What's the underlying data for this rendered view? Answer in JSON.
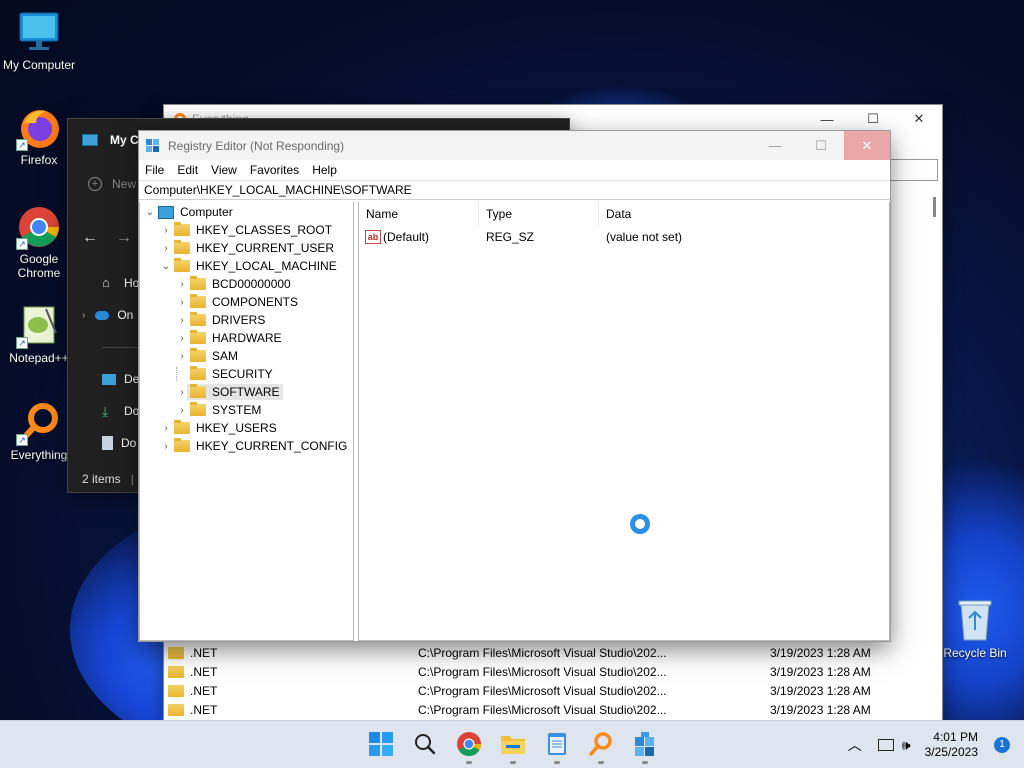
{
  "desktop": {
    "icons": [
      {
        "label": "My Computer"
      },
      {
        "label": "Firefox"
      },
      {
        "label": "Google Chrome"
      },
      {
        "label": "Notepad++"
      },
      {
        "label": "Everything"
      }
    ],
    "recycle_bin": "Recycle Bin"
  },
  "everything_window": {
    "title": "Everything",
    "rows": [
      {
        "name": ".NET",
        "path": "C:\\Program Files\\Microsoft Visual Studio\\202...",
        "date": "3/19/2023 1:28 AM"
      },
      {
        "name": ".NET",
        "path": "C:\\Program Files\\Microsoft Visual Studio\\202...",
        "date": "3/19/2023 1:28 AM"
      },
      {
        "name": ".NET",
        "path": "C:\\Program Files\\Microsoft Visual Studio\\202...",
        "date": "3/19/2023 1:28 AM"
      },
      {
        "name": ".NET",
        "path": "C:\\Program Files\\Microsoft Visual Studio\\202...",
        "date": "3/19/2023 1:28 AM"
      }
    ]
  },
  "explorer_window": {
    "title": "My C",
    "new_label": "New",
    "nav_items": [
      {
        "label": "Ho",
        "icon": "home-icon"
      },
      {
        "label": "On",
        "icon": "cloud-icon"
      },
      {
        "label": "De",
        "icon": "desktop-icon"
      },
      {
        "label": "Do",
        "icon": "download-icon"
      },
      {
        "label": "Do",
        "icon": "document-icon"
      }
    ],
    "status": "2 items"
  },
  "regedit": {
    "title": "Registry Editor (Not Responding)",
    "menu": [
      "File",
      "Edit",
      "View",
      "Favorites",
      "Help"
    ],
    "address": "Computer\\HKEY_LOCAL_MACHINE\\SOFTWARE",
    "tree": {
      "root": "Computer",
      "hives": [
        "HKEY_CLASSES_ROOT",
        "HKEY_CURRENT_USER",
        "HKEY_LOCAL_MACHINE",
        "HKEY_USERS",
        "HKEY_CURRENT_CONFIG"
      ],
      "hklm_children": [
        "BCD00000000",
        "COMPONENTS",
        "DRIVERS",
        "HARDWARE",
        "SAM",
        "SECURITY",
        "SOFTWARE",
        "SYSTEM"
      ],
      "selected": "SOFTWARE"
    },
    "columns": [
      "Name",
      "Type",
      "Data"
    ],
    "values": [
      {
        "name": "(Default)",
        "type": "REG_SZ",
        "data": "(value not set)",
        "icon": "string-value-icon"
      }
    ]
  },
  "taskbar": {
    "apps": [
      "start-icon",
      "search-icon",
      "chrome-icon",
      "file-explorer-icon",
      "notepad-icon",
      "everything-icon",
      "regedit-icon"
    ],
    "clock_time": "4:01 PM",
    "clock_date": "3/25/2023",
    "notification_count": "1"
  }
}
